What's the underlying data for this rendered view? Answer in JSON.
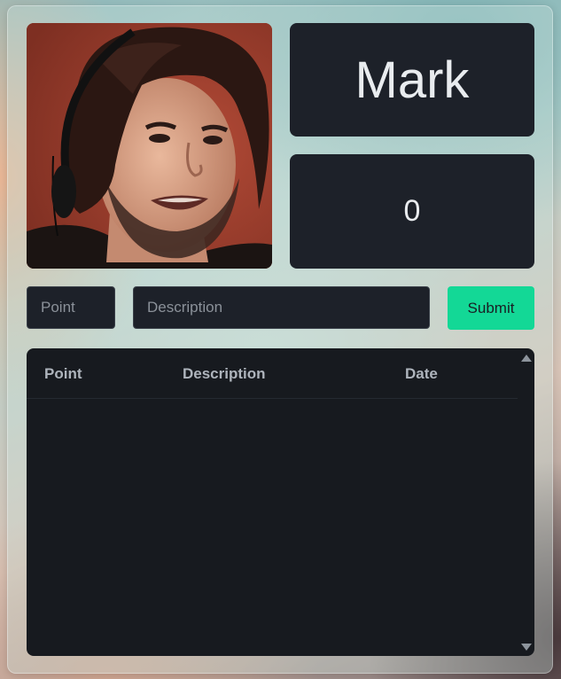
{
  "profile": {
    "name": "Mark",
    "score": "0",
    "avatar_icon": "profile-photo"
  },
  "form": {
    "point_placeholder": "Point",
    "description_placeholder": "Description",
    "submit_label": "Submit"
  },
  "table": {
    "headers": {
      "point": "Point",
      "description": "Description",
      "date": "Date"
    },
    "rows": []
  },
  "colors": {
    "submit": "#13d896",
    "card": "#1d2129",
    "table_bg": "#171a1f"
  }
}
